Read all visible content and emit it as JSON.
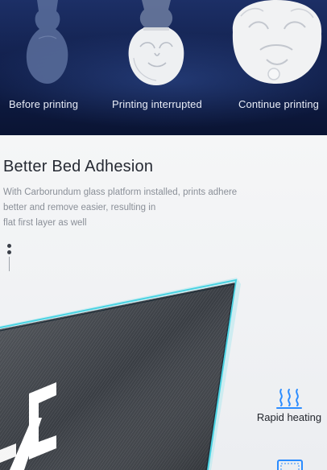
{
  "banner": {
    "stages": [
      {
        "label": "Before printing"
      },
      {
        "label": "Printing interrupted"
      },
      {
        "label": "Continue printing"
      }
    ]
  },
  "section": {
    "title": "Better Bed Adhesion",
    "description_lines": [
      "With Carborundum glass platform installed, prints adhere",
      "better and remove easier, resulting in",
      "flat first layer as well"
    ],
    "features": [
      {
        "label": "Rapid heating",
        "icon": "heat-waves-icon"
      },
      {
        "label": "",
        "icon": "heated-bed-icon"
      }
    ]
  },
  "colors": {
    "banner_bg": "#0f1c45",
    "accent": "#2b8cff",
    "platform_edge": "#3fd1e0"
  }
}
